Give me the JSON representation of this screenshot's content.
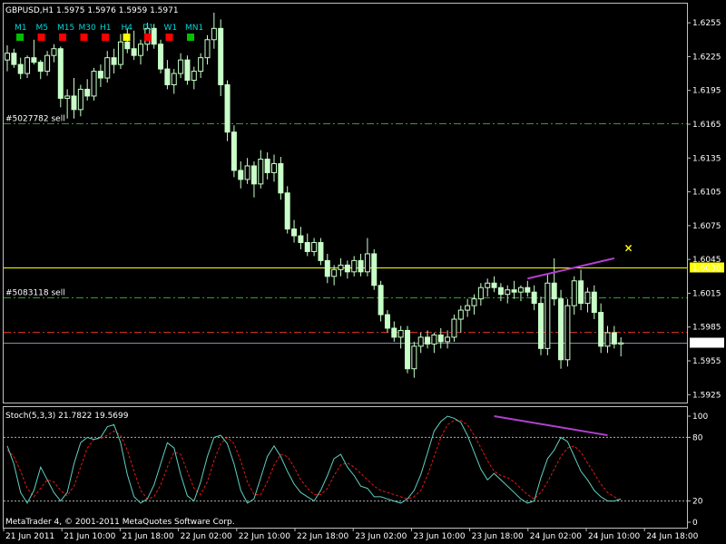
{
  "header": {
    "symbol_line": "GBPUSD,H1  1.5975 1.5976 1.5959 1.5971",
    "copyright": "MetaTrader 4, © 2001-2011 MetaQuotes Software Corp."
  },
  "timeframes": [
    {
      "label": "M1",
      "color": "#00c000"
    },
    {
      "label": "M5",
      "color": "#ff0000"
    },
    {
      "label": "M15",
      "color": "#ff0000"
    },
    {
      "label": "M30",
      "color": "#ff0000"
    },
    {
      "label": "H1",
      "color": "#ff0000"
    },
    {
      "label": "H4",
      "color": "#ffff00"
    },
    {
      "label": "D1",
      "color": "#ff0000"
    },
    {
      "label": "W1",
      "color": "#ff0000"
    },
    {
      "label": "MN1",
      "color": "#00c000"
    }
  ],
  "colors": {
    "candle": "#c8ffc8",
    "grid_frame": "#c0c0c0",
    "order_line": "#2ea02e",
    "resistance": "#ffff00",
    "current_price_line": "#8090a0",
    "red_level": "#d03020",
    "trendline": "#b040d0",
    "stoch_main": "#5fd0c0",
    "stoch_signal": "#e01818"
  },
  "chart_data": [
    {
      "type": "candlestick",
      "title": "GBPUSD,H1",
      "ohlc_header": {
        "open": 1.5975,
        "high": 1.5976,
        "low": 1.5959,
        "close": 1.5971
      },
      "ylim": [
        1.5918,
        1.6272
      ],
      "y_ticks": [
        "1.6255",
        "1.6225",
        "1.6195",
        "1.6165",
        "1.6135",
        "1.6105",
        "1.6075",
        "1.6045",
        "1.6015",
        "1.5985",
        "1.5955",
        "1.5925"
      ],
      "x_ticks": [
        "21 Jun 2011",
        "21 Jun 10:00",
        "21 Jun 18:00",
        "22 Jun 02:00",
        "22 Jun 10:00",
        "22 Jun 18:00",
        "23 Jun 02:00",
        "23 Jun 10:00",
        "23 Jun 18:00",
        "24 Jun 02:00",
        "24 Jun 10:00",
        "24 Jun 18:00"
      ],
      "horizontal_lines": [
        {
          "label": "#5027782 sell",
          "value": 1.6166,
          "style": "dash-dot",
          "color_key": "order_line"
        },
        {
          "label": "#5083118 sell",
          "value": 1.6011,
          "style": "dash-dot",
          "color_key": "order_line"
        },
        {
          "label": "1.6038",
          "value": 1.6038,
          "style": "solid",
          "color_key": "resistance"
        },
        {
          "label": "",
          "value": 1.5981,
          "style": "dash-dot",
          "color_key": "red_level"
        },
        {
          "label": "1.5971",
          "value": 1.5971,
          "style": "solid",
          "color_key": "current_price_line"
        }
      ],
      "trendline": {
        "from": {
          "bar": 78,
          "price": 1.6028
        },
        "to": {
          "bar": 91,
          "price": 1.6046
        }
      },
      "marker": {
        "symbol": "×",
        "bar": 93,
        "price": 1.6055
      },
      "candles": [
        [
          1.6222,
          1.6235,
          1.6212,
          1.6228
        ],
        [
          1.6228,
          1.6232,
          1.6215,
          1.6218
        ],
        [
          1.6218,
          1.6224,
          1.6205,
          1.621
        ],
        [
          1.621,
          1.6226,
          1.6206,
          1.6224
        ],
        [
          1.6224,
          1.624,
          1.6218,
          1.622
        ],
        [
          1.622,
          1.6222,
          1.6205,
          1.6212
        ],
        [
          1.6212,
          1.623,
          1.6208,
          1.6226
        ],
        [
          1.6226,
          1.6236,
          1.622,
          1.6232
        ],
        [
          1.6232,
          1.6234,
          1.618,
          1.6188
        ],
        [
          1.6188,
          1.6196,
          1.617,
          1.619
        ],
        [
          1.619,
          1.6206,
          1.617,
          1.6178
        ],
        [
          1.6178,
          1.62,
          1.6172,
          1.6196
        ],
        [
          1.6196,
          1.6205,
          1.6186,
          1.619
        ],
        [
          1.619,
          1.6215,
          1.6186,
          1.6212
        ],
        [
          1.6212,
          1.6218,
          1.6198,
          1.6206
        ],
        [
          1.6206,
          1.623,
          1.6202,
          1.6224
        ],
        [
          1.6224,
          1.6232,
          1.621,
          1.6218
        ],
        [
          1.6218,
          1.6245,
          1.6214,
          1.6238
        ],
        [
          1.6238,
          1.625,
          1.6228,
          1.6232
        ],
        [
          1.6232,
          1.6248,
          1.6222,
          1.6226
        ],
        [
          1.6226,
          1.624,
          1.6218,
          1.6236
        ],
        [
          1.6236,
          1.6255,
          1.623,
          1.625
        ],
        [
          1.625,
          1.6254,
          1.6232,
          1.6236
        ],
        [
          1.6236,
          1.624,
          1.621,
          1.6214
        ],
        [
          1.6214,
          1.6222,
          1.6196,
          1.62
        ],
        [
          1.62,
          1.6214,
          1.6192,
          1.621
        ],
        [
          1.621,
          1.6228,
          1.6206,
          1.6222
        ],
        [
          1.6222,
          1.6226,
          1.62,
          1.6204
        ],
        [
          1.6204,
          1.6216,
          1.6196,
          1.6212
        ],
        [
          1.6212,
          1.6228,
          1.6206,
          1.6224
        ],
        [
          1.6224,
          1.6244,
          1.6218,
          1.624
        ],
        [
          1.624,
          1.6264,
          1.6232,
          1.625
        ],
        [
          1.625,
          1.6258,
          1.619,
          1.62
        ],
        [
          1.62,
          1.6204,
          1.615,
          1.6158
        ],
        [
          1.6158,
          1.6164,
          1.6118,
          1.6124
        ],
        [
          1.6124,
          1.6132,
          1.6108,
          1.6116
        ],
        [
          1.6116,
          1.6135,
          1.6112,
          1.6128
        ],
        [
          1.6128,
          1.6132,
          1.61,
          1.6112
        ],
        [
          1.6112,
          1.6142,
          1.6108,
          1.6134
        ],
        [
          1.6134,
          1.614,
          1.6116,
          1.6122
        ],
        [
          1.6122,
          1.6138,
          1.6114,
          1.613
        ],
        [
          1.613,
          1.6136,
          1.6098,
          1.6104
        ],
        [
          1.6104,
          1.611,
          1.6068,
          1.6072
        ],
        [
          1.6072,
          1.608,
          1.606,
          1.6066
        ],
        [
          1.6066,
          1.6074,
          1.6054,
          1.606
        ],
        [
          1.606,
          1.6068,
          1.6048,
          1.6052
        ],
        [
          1.6052,
          1.6064,
          1.6048,
          1.606
        ],
        [
          1.606,
          1.6064,
          1.604,
          1.6044
        ],
        [
          1.6044,
          1.605,
          1.6024,
          1.603
        ],
        [
          1.603,
          1.604,
          1.6022,
          1.6036
        ],
        [
          1.6036,
          1.6046,
          1.603,
          1.604
        ],
        [
          1.604,
          1.6044,
          1.6028,
          1.6034
        ],
        [
          1.6034,
          1.6048,
          1.603,
          1.6044
        ],
        [
          1.6044,
          1.605,
          1.603,
          1.6034
        ],
        [
          1.6034,
          1.6064,
          1.603,
          1.605
        ],
        [
          1.605,
          1.6054,
          1.6018,
          1.6022
        ],
        [
          1.6022,
          1.6026,
          1.599,
          1.5996
        ],
        [
          1.5996,
          1.6,
          1.598,
          1.5984
        ],
        [
          1.5984,
          1.599,
          1.5972,
          1.5976
        ],
        [
          1.5976,
          1.5986,
          1.5966,
          1.5982
        ],
        [
          1.5982,
          1.5986,
          1.5944,
          1.5948
        ],
        [
          1.5948,
          1.5972,
          1.594,
          1.5968
        ],
        [
          1.5968,
          1.598,
          1.5962,
          1.5976
        ],
        [
          1.5976,
          1.5982,
          1.5966,
          1.597
        ],
        [
          1.597,
          1.598,
          1.5962,
          1.5978
        ],
        [
          1.5978,
          1.5984,
          1.5966,
          1.5972
        ],
        [
          1.5972,
          1.5982,
          1.5966,
          1.5976
        ],
        [
          1.5976,
          1.5996,
          1.5972,
          1.5992
        ],
        [
          1.5992,
          1.6004,
          1.598,
          1.6
        ],
        [
          1.6,
          1.601,
          1.5994,
          1.6004
        ],
        [
          1.6004,
          1.6014,
          1.5996,
          1.601
        ],
        [
          1.601,
          1.6024,
          1.6004,
          1.602
        ],
        [
          1.602,
          1.6028,
          1.6012,
          1.6024
        ],
        [
          1.6024,
          1.603,
          1.6016,
          1.602
        ],
        [
          1.602,
          1.6024,
          1.6008,
          1.6014
        ],
        [
          1.6014,
          1.6022,
          1.6006,
          1.6018
        ],
        [
          1.6018,
          1.6026,
          1.601,
          1.6016
        ],
        [
          1.6016,
          1.6022,
          1.6008,
          1.602
        ],
        [
          1.602,
          1.6026,
          1.6012,
          1.6016
        ],
        [
          1.6016,
          1.6022,
          1.6,
          1.6006
        ],
        [
          1.6006,
          1.6012,
          1.596,
          1.5966
        ],
        [
          1.5966,
          1.6032,
          1.596,
          1.6024
        ],
        [
          1.6024,
          1.6046,
          1.6004,
          1.601
        ],
        [
          1.601,
          1.6018,
          1.5948,
          1.5956
        ],
        [
          1.5956,
          1.601,
          1.595,
          1.6004
        ],
        [
          1.6004,
          1.603,
          1.5996,
          1.6026
        ],
        [
          1.6026,
          1.6036,
          1.6,
          1.6006
        ],
        [
          1.6006,
          1.602,
          1.5998,
          1.6016
        ],
        [
          1.6016,
          1.6022,
          1.5992,
          1.5998
        ],
        [
          1.5998,
          1.6006,
          1.5962,
          1.5968
        ],
        [
          1.5968,
          1.5986,
          1.5962,
          1.598
        ],
        [
          1.598,
          1.5986,
          1.5966,
          1.597
        ],
        [
          1.597,
          1.5976,
          1.5959,
          1.5971
        ]
      ]
    },
    {
      "type": "line",
      "title": "Stoch(5,3,3) 21.7822 19.5699",
      "ylim": [
        0,
        100
      ],
      "y_ticks": [
        "100",
        "80",
        "20",
        "0"
      ],
      "levels": [
        80,
        20
      ],
      "series": [
        {
          "values": [
            72,
            55,
            28,
            18,
            30,
            52,
            40,
            28,
            20,
            28,
            55,
            75,
            80,
            78,
            80,
            90,
            92,
            75,
            45,
            24,
            18,
            22,
            35,
            55,
            75,
            70,
            45,
            25,
            20,
            38,
            62,
            80,
            82,
            74,
            55,
            30,
            18,
            22,
            42,
            62,
            72,
            62,
            48,
            36,
            28,
            24,
            20,
            30,
            44,
            60,
            64,
            52,
            44,
            34,
            32,
            24,
            24,
            22,
            20,
            18,
            22,
            30,
            45,
            65,
            86,
            95,
            100,
            98,
            94,
            82,
            66,
            50,
            40,
            46,
            40,
            34,
            28,
            22,
            18,
            20,
            42,
            60,
            68,
            80,
            76,
            62,
            48,
            40,
            30,
            24,
            20,
            20,
            22
          ]
        },
        {
          "values": [
            68,
            62,
            48,
            32,
            24,
            32,
            40,
            38,
            30,
            25,
            34,
            52,
            70,
            78,
            79,
            82,
            86,
            82,
            68,
            48,
            30,
            22,
            24,
            35,
            52,
            66,
            64,
            48,
            32,
            26,
            38,
            58,
            74,
            80,
            74,
            58,
            38,
            26,
            26,
            38,
            54,
            64,
            62,
            52,
            40,
            32,
            26,
            26,
            32,
            44,
            54,
            56,
            52,
            46,
            40,
            34,
            30,
            28,
            26,
            24,
            22,
            24,
            30,
            44,
            62,
            80,
            92,
            96,
            96,
            92,
            82,
            70,
            58,
            48,
            44,
            42,
            38,
            32,
            26,
            22,
            28,
            38,
            50,
            62,
            70,
            72,
            66,
            56,
            46,
            36,
            28,
            24,
            20
          ]
        }
      ]
    }
  ]
}
